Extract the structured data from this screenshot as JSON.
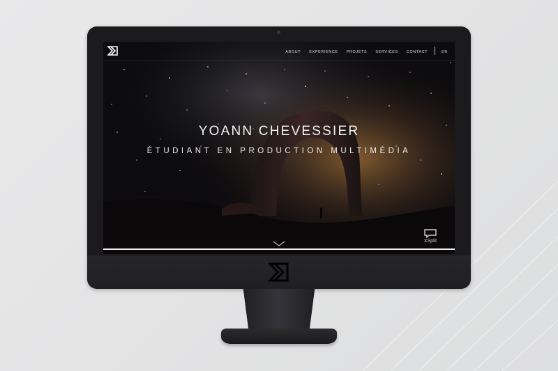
{
  "site": {
    "nav": {
      "items": [
        "ABOUT",
        "EXPERIENCE",
        "PROJETS",
        "SERVICES",
        "CONTACT"
      ],
      "language": "EN"
    },
    "hero": {
      "name": "YOANN CHEVESSIER",
      "subtitle": "ÉTUDIANT EN PRODUCTION MULTIMÉDIA"
    },
    "watermark": {
      "label": "XSplit"
    }
  },
  "colors": {
    "bezel": "#1b1b1d",
    "background": "#e6e6e7",
    "hero_text": "#f0f0f0",
    "nav_text": "#d9d9d9"
  },
  "icons": [
    "logo-icon",
    "chevron-down-icon",
    "xsplit-icon"
  ]
}
